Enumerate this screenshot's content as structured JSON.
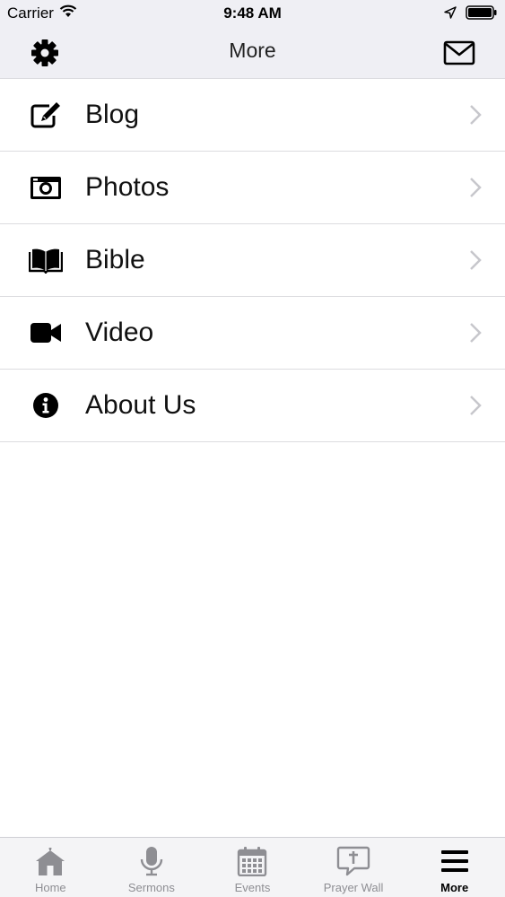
{
  "status_bar": {
    "carrier": "Carrier",
    "time": "9:48 AM",
    "icons": [
      "wifi-icon",
      "location-arrow-icon",
      "battery-icon"
    ]
  },
  "nav_bar": {
    "title": "More",
    "left_icon": "gear-icon",
    "right_icon": "mail-icon"
  },
  "menu": {
    "items": [
      {
        "label": "Blog",
        "icon": "edit-icon"
      },
      {
        "label": "Photos",
        "icon": "camera-icon"
      },
      {
        "label": "Bible",
        "icon": "book-icon"
      },
      {
        "label": "Video",
        "icon": "video-camera-icon"
      },
      {
        "label": "About Us",
        "icon": "info-icon"
      }
    ]
  },
  "tab_bar": {
    "tabs": [
      {
        "label": "Home",
        "icon": "home-icon",
        "active": false
      },
      {
        "label": "Sermons",
        "icon": "microphone-icon",
        "active": false
      },
      {
        "label": "Events",
        "icon": "calendar-icon",
        "active": false
      },
      {
        "label": "Prayer Wall",
        "icon": "prayer-bubble-icon",
        "active": false
      },
      {
        "label": "More",
        "icon": "hamburger-icon",
        "active": true
      }
    ]
  },
  "colors": {
    "bar_background": "#efeff4",
    "divider": "#dcdce0",
    "tab_inactive": "#8e8e93",
    "tab_active": "#000000",
    "chevron": "#c7c7cc"
  }
}
